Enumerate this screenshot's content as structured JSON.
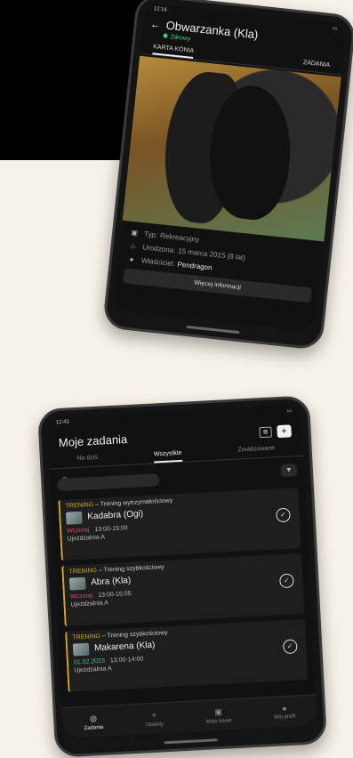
{
  "phone1": {
    "status_time": "12:14",
    "horse_name": "Obwarzanka (Kla)",
    "health_status": "Zdrowy",
    "tabs": [
      "KARTA KONIA",
      "ZADANIA"
    ],
    "info": {
      "type_label": "Typ:",
      "type_value": "Rekreacyjny",
      "birth_label": "Urodzona:",
      "birth_value": "15 marca 2015 (8 lat)",
      "owner_label": "Właściciel:",
      "owner_value": "Pendragon"
    },
    "more_button": "Więcej informacji"
  },
  "phone2": {
    "status_time": "12:43",
    "title": "Moje zadania",
    "tabs": [
      "Na dziś",
      "Wszystkie",
      "Zrealizowane"
    ],
    "tasks": [
      {
        "category": "TRENING",
        "title": "Trening wytrzymałościowy",
        "horse": "Kadabra (Ogi)",
        "date": "Wczoraj",
        "time": "13:00-15:00",
        "place": "Ujeżdżalnia A"
      },
      {
        "category": "TRENING",
        "title": "Trening szybkościowy",
        "horse": "Abra (Kla)",
        "date": "Wczoraj",
        "time": "13:00-15:05",
        "place": "Ujeżdżalnia A"
      },
      {
        "category": "TRENING",
        "title": "Trening szybkościowy",
        "horse": "Makarena (Kla)",
        "date": "01.02.2023",
        "time": "13:00-14:00",
        "place": "Ujeżdżalnia A"
      }
    ],
    "nav": [
      "Zadania",
      "Obiekty",
      "Moje konie",
      "Mój profil"
    ]
  },
  "colors": {
    "background": "#f7f2e8",
    "accent_gold": "#d4a72c",
    "status_green": "#3ccf7a",
    "date_red": "#e24b5a"
  }
}
